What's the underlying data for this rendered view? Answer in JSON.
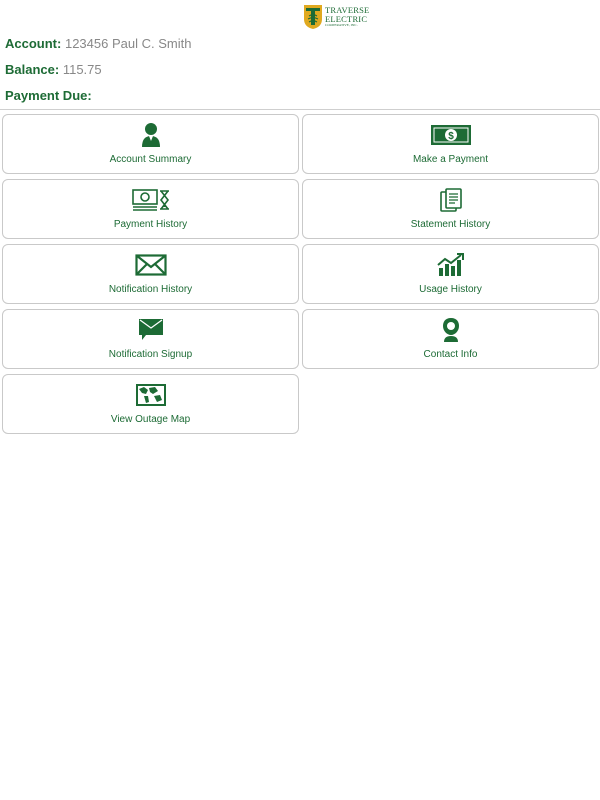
{
  "logo": {
    "line1": "TRAVERSE",
    "line2": "ELECTRIC",
    "line3": "COOPERATIVE, INC."
  },
  "account": {
    "label": "Account:",
    "value": "123456 Paul C. Smith"
  },
  "balance": {
    "label": "Balance:",
    "value": "115.75"
  },
  "payment_due": {
    "label": "Payment Due:",
    "value": ""
  },
  "colors": {
    "brand_green": "#1d6b35",
    "value_gray": "#888888",
    "logo_gold": "#e0a91f"
  },
  "menu": [
    {
      "label": "Account Summary",
      "icon": "person-icon"
    },
    {
      "label": "Make a Payment",
      "icon": "cash-icon"
    },
    {
      "label": "Payment History",
      "icon": "money-history-icon"
    },
    {
      "label": "Statement History",
      "icon": "documents-icon"
    },
    {
      "label": "Notification History",
      "icon": "envelope-icon"
    },
    {
      "label": "Usage History",
      "icon": "chart-growth-icon"
    },
    {
      "label": "Notification Signup",
      "icon": "message-envelope-icon"
    },
    {
      "label": "Contact Info",
      "icon": "contact-person-icon"
    },
    {
      "label": "View Outage Map",
      "icon": "map-icon"
    }
  ]
}
